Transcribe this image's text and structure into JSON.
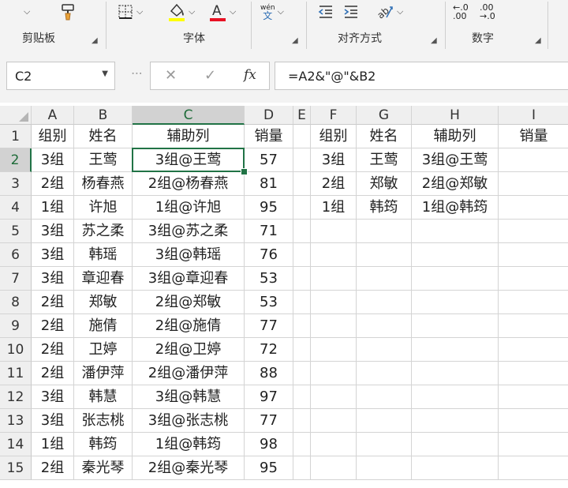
{
  "ribbon": {
    "groups": [
      {
        "label": "剪贴板"
      },
      {
        "label": "字体"
      },
      {
        "label": "对齐方式"
      },
      {
        "label": "数字"
      }
    ],
    "wen_label": "wén",
    "wen_char": "文",
    "num_inc_top": "←.0",
    "num_inc_bottom": ".00",
    "num_dec_top": ".00",
    "num_dec_bottom": "→.0",
    "highlight_color": "#ffff00",
    "font_color": "#e81123"
  },
  "formula_bar": {
    "name_box": "C2",
    "cancel": "✕",
    "enter": "✓",
    "fx": "fx",
    "formula": "=A2&\"@\"&B2"
  },
  "sheet": {
    "columns": [
      "A",
      "B",
      "C",
      "D",
      "E",
      "F",
      "G",
      "H",
      "I"
    ],
    "selected_column": "C",
    "selected_row": "2",
    "rows": [
      {
        "n": "1",
        "cells": [
          "组别",
          "姓名",
          "辅助列",
          "销量",
          "",
          "组别",
          "姓名",
          "辅助列",
          "销量"
        ]
      },
      {
        "n": "2",
        "cells": [
          "3组",
          "王莺",
          "3组@王莺",
          "57",
          "",
          "3组",
          "王莺",
          "3组@王莺",
          ""
        ]
      },
      {
        "n": "3",
        "cells": [
          "2组",
          "杨春燕",
          "2组@杨春燕",
          "81",
          "",
          "2组",
          "郑敏",
          "2组@郑敏",
          ""
        ]
      },
      {
        "n": "4",
        "cells": [
          "1组",
          "许旭",
          "1组@许旭",
          "95",
          "",
          "1组",
          "韩筠",
          "1组@韩筠",
          ""
        ]
      },
      {
        "n": "5",
        "cells": [
          "3组",
          "苏之柔",
          "3组@苏之柔",
          "71",
          "",
          "",
          "",
          "",
          ""
        ]
      },
      {
        "n": "6",
        "cells": [
          "3组",
          "韩瑶",
          "3组@韩瑶",
          "76",
          "",
          "",
          "",
          "",
          ""
        ]
      },
      {
        "n": "7",
        "cells": [
          "3组",
          "章迎春",
          "3组@章迎春",
          "53",
          "",
          "",
          "",
          "",
          ""
        ]
      },
      {
        "n": "8",
        "cells": [
          "2组",
          "郑敏",
          "2组@郑敏",
          "53",
          "",
          "",
          "",
          "",
          ""
        ]
      },
      {
        "n": "9",
        "cells": [
          "2组",
          "施倩",
          "2组@施倩",
          "77",
          "",
          "",
          "",
          "",
          ""
        ]
      },
      {
        "n": "10",
        "cells": [
          "2组",
          "卫婷",
          "2组@卫婷",
          "72",
          "",
          "",
          "",
          "",
          ""
        ]
      },
      {
        "n": "11",
        "cells": [
          "2组",
          "潘伊萍",
          "2组@潘伊萍",
          "88",
          "",
          "",
          "",
          "",
          ""
        ]
      },
      {
        "n": "12",
        "cells": [
          "3组",
          "韩慧",
          "3组@韩慧",
          "97",
          "",
          "",
          "",
          "",
          ""
        ]
      },
      {
        "n": "13",
        "cells": [
          "3组",
          "张志桃",
          "3组@张志桃",
          "77",
          "",
          "",
          "",
          "",
          ""
        ]
      },
      {
        "n": "14",
        "cells": [
          "1组",
          "韩筠",
          "1组@韩筠",
          "98",
          "",
          "",
          "",
          "",
          ""
        ]
      },
      {
        "n": "15",
        "cells": [
          "2组",
          "秦光琴",
          "2组@秦光琴",
          "95",
          "",
          "",
          "",
          "",
          ""
        ]
      }
    ]
  }
}
